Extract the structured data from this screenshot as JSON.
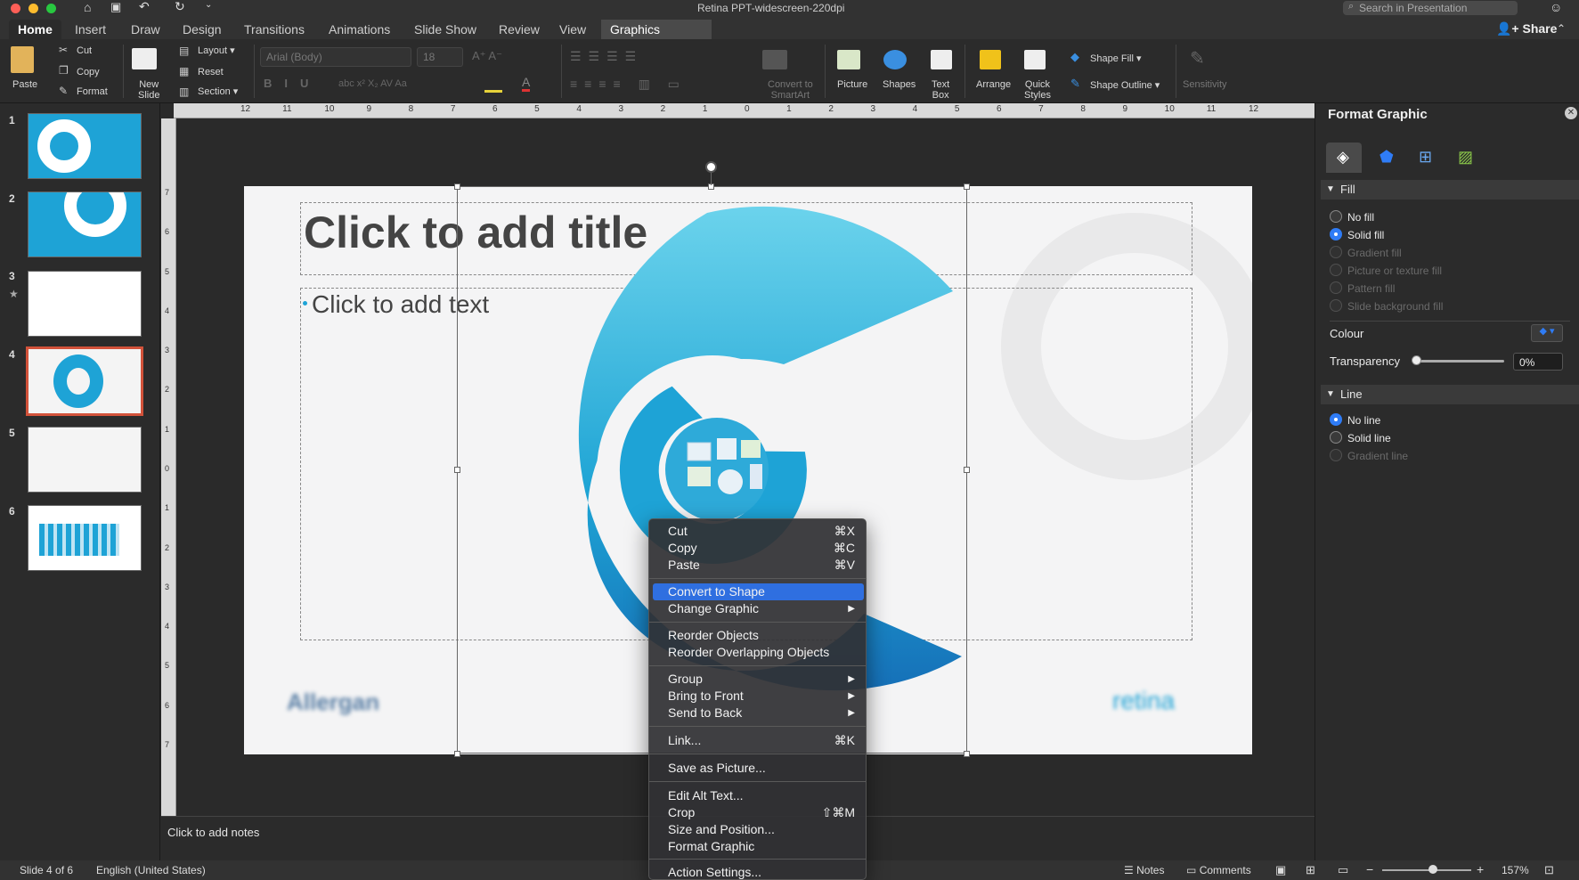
{
  "window": {
    "title": "Retina PPT-widescreen-220dpi",
    "search_placeholder": "Search in Presentation",
    "share_label": "Share"
  },
  "tabs": [
    {
      "label": "Home"
    },
    {
      "label": "Insert"
    },
    {
      "label": "Draw"
    },
    {
      "label": "Design"
    },
    {
      "label": "Transitions"
    },
    {
      "label": "Animations"
    },
    {
      "label": "Slide Show"
    },
    {
      "label": "Review"
    },
    {
      "label": "View"
    },
    {
      "label": "Graphics Format"
    }
  ],
  "ribbon": {
    "paste": "Paste",
    "cut": "Cut",
    "copy": "Copy",
    "format": "Format",
    "new_slide_line1": "New",
    "new_slide_line2": "Slide",
    "layout": "Layout",
    "reset": "Reset",
    "section": "Section",
    "font_name": "Arial (Body)",
    "font_size": "18",
    "convert_line1": "Convert to",
    "convert_line2": "SmartArt",
    "picture": "Picture",
    "shapes": "Shapes",
    "textbox_line1": "Text",
    "textbox_line2": "Box",
    "arrange": "Arrange",
    "quick_line1": "Quick",
    "quick_line2": "Styles",
    "shape_fill": "Shape Fill",
    "shape_outline": "Shape Outline",
    "sensitivity": "Sensitivity"
  },
  "slides": [
    {
      "num": "1"
    },
    {
      "num": "2"
    },
    {
      "num": "3",
      "star": "★"
    },
    {
      "num": "4"
    },
    {
      "num": "5"
    },
    {
      "num": "6"
    }
  ],
  "ruler_h": [
    "12",
    "11",
    "10",
    "9",
    "8",
    "7",
    "6",
    "5",
    "4",
    "3",
    "2",
    "1",
    "0",
    "1",
    "2",
    "3",
    "4",
    "5",
    "6",
    "7",
    "8",
    "9",
    "10",
    "11",
    "12"
  ],
  "ruler_v": [
    "7",
    "6",
    "5",
    "4",
    "3",
    "2",
    "1",
    "0",
    "1",
    "2",
    "3",
    "4",
    "5",
    "6",
    "7"
  ],
  "slide": {
    "title_placeholder": "Click to add title",
    "text_placeholder": "Click to add text",
    "logo_left": "Allergan",
    "logo_right": "retina"
  },
  "notes_placeholder": "Click to add notes",
  "format_pane": {
    "title": "Format Graphic",
    "fill_section": "Fill",
    "fill_options": [
      {
        "label": "No fill",
        "selected": false,
        "enabled": true
      },
      {
        "label": "Solid fill",
        "selected": true,
        "enabled": true
      },
      {
        "label": "Gradient fill",
        "selected": false,
        "enabled": false
      },
      {
        "label": "Picture or texture fill",
        "selected": false,
        "enabled": false
      },
      {
        "label": "Pattern fill",
        "selected": false,
        "enabled": false
      },
      {
        "label": "Slide background fill",
        "selected": false,
        "enabled": false
      }
    ],
    "colour_label": "Colour",
    "transparency_label": "Transparency",
    "transparency_value": "0%",
    "line_section": "Line",
    "line_options": [
      {
        "label": "No line",
        "selected": true,
        "enabled": true
      },
      {
        "label": "Solid line",
        "selected": false,
        "enabled": true
      },
      {
        "label": "Gradient line",
        "selected": false,
        "enabled": false
      }
    ]
  },
  "context_menu": {
    "cut": "Cut",
    "cut_sc": "⌘X",
    "copy": "Copy",
    "copy_sc": "⌘C",
    "paste": "Paste",
    "paste_sc": "⌘V",
    "convert": "Convert to Shape",
    "change": "Change Graphic",
    "reorder": "Reorder Objects",
    "reorder_overlap": "Reorder Overlapping Objects",
    "group": "Group",
    "bring_front": "Bring to Front",
    "send_back": "Send to Back",
    "link": "Link...",
    "link_sc": "⌘K",
    "save_picture": "Save as Picture...",
    "alt_text": "Edit Alt Text...",
    "crop": "Crop",
    "crop_sc": "⇧⌘M",
    "size_pos": "Size and Position...",
    "format_graphic": "Format Graphic",
    "action": "Action Settings..."
  },
  "status": {
    "slide": "Slide 4 of 6",
    "language": "English (United States)",
    "notes": "Notes",
    "comments": "Comments",
    "zoom": "157%"
  },
  "colors": {
    "accent": "#2f7cf6",
    "brand_blue": "#1ea3d6",
    "selected_thumb": "#d2523a"
  }
}
